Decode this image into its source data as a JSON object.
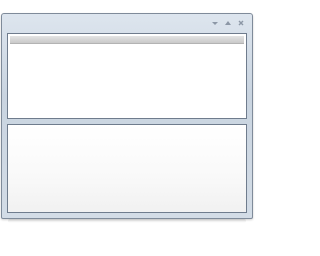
{
  "window": {
    "title": "",
    "controls": [
      "minimize-icon",
      "maximize-icon",
      "close-icon"
    ]
  },
  "colors": {
    "frame": "#c9d4e0",
    "pane_border": "#6f7c8d",
    "header": "#d0d0d0",
    "content": "#ffffff"
  }
}
